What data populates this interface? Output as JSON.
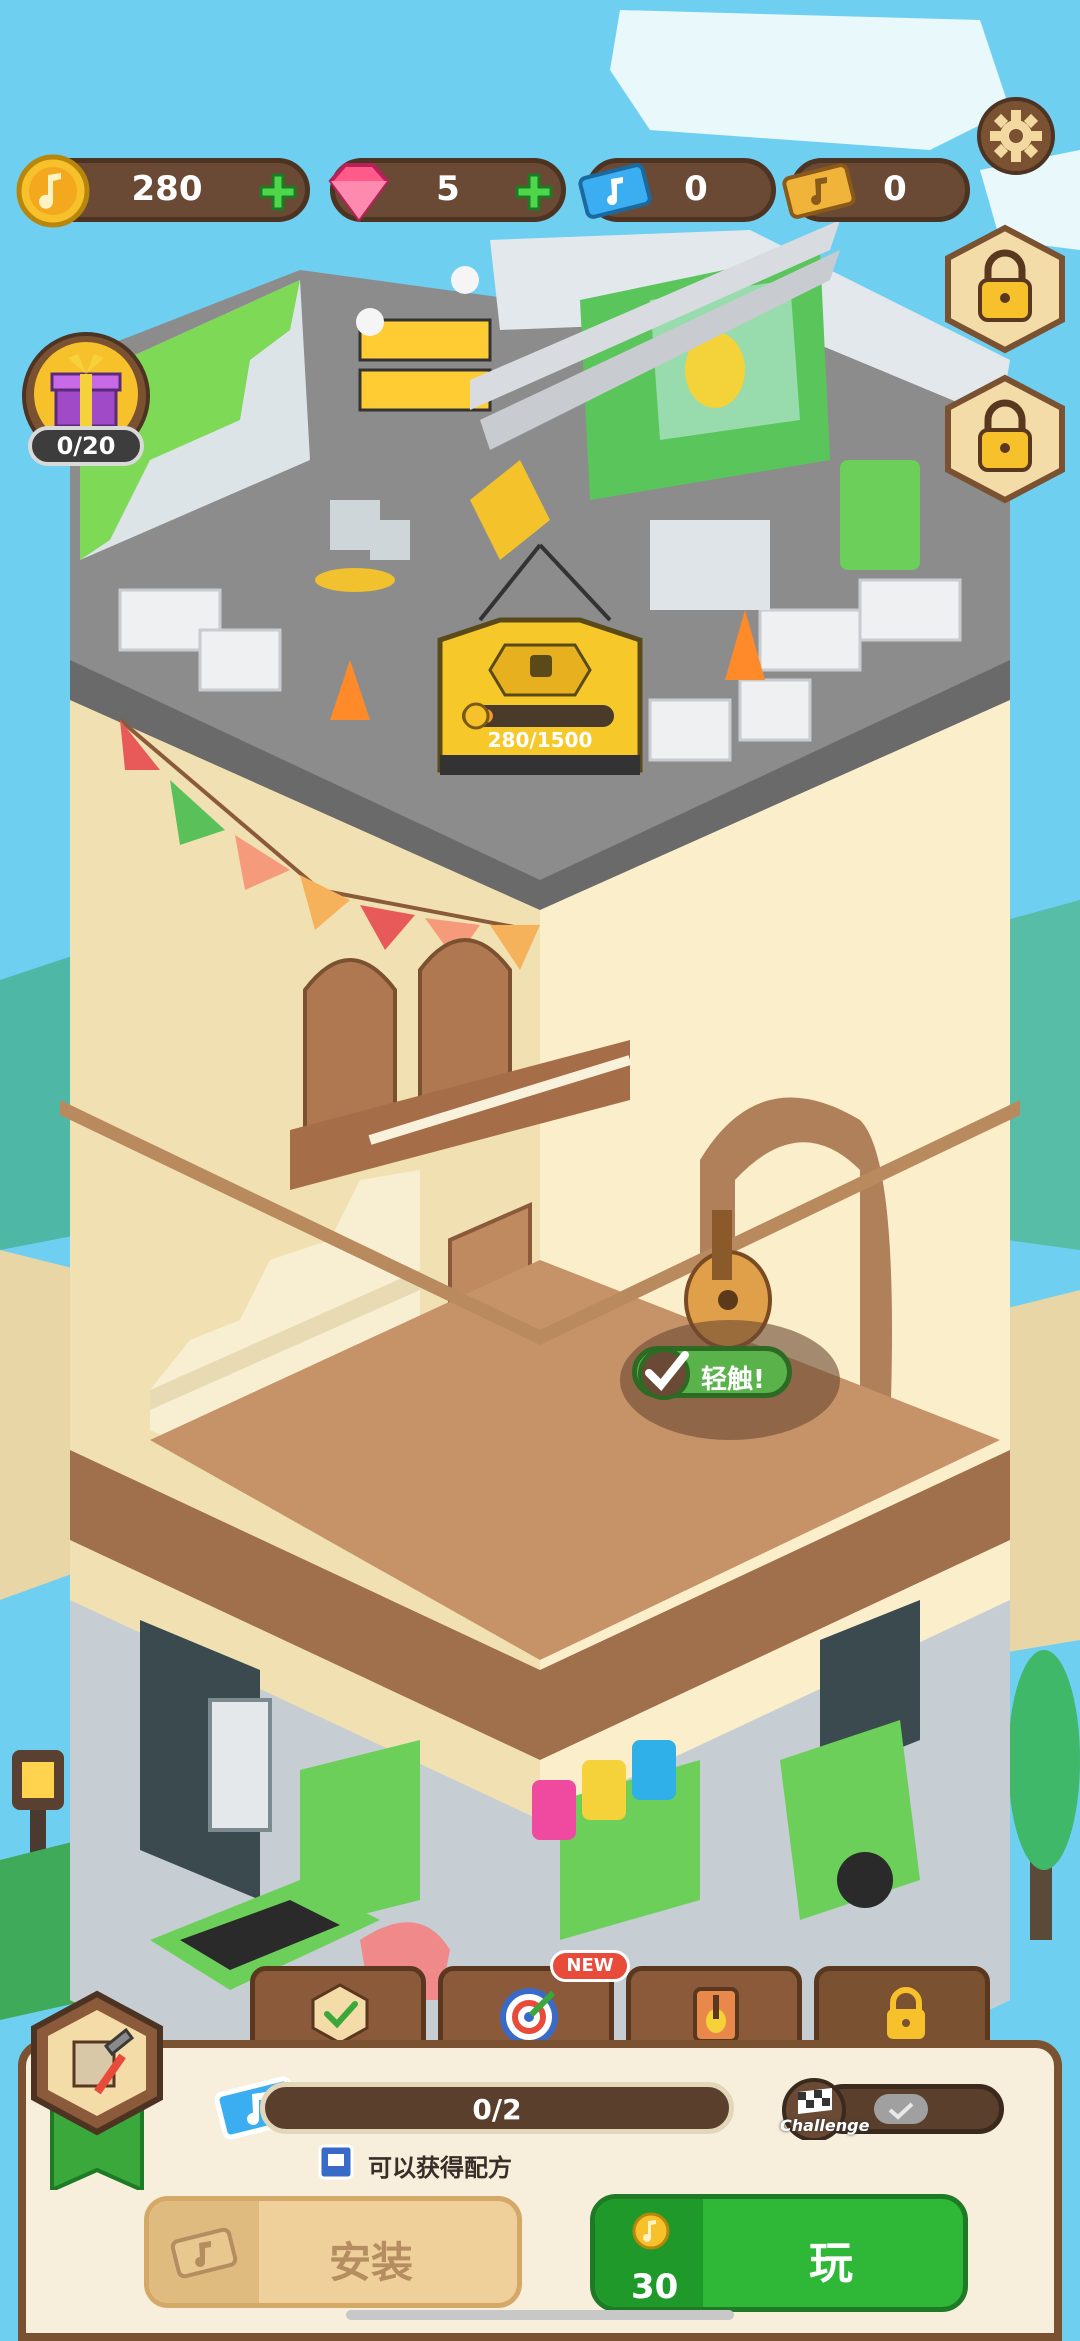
{
  "hud": {
    "notes": "280",
    "gems": "5",
    "blue_tickets": "0",
    "gold_tickets": "0"
  },
  "gift": {
    "count": "0/20"
  },
  "construction": {
    "progress_text": "280/1500",
    "progress": 0.187
  },
  "tap_prompt": "轻触!",
  "tabs": [
    {
      "icon": "checklist-icon"
    },
    {
      "icon": "target-icon",
      "badge": "NEW"
    },
    {
      "icon": "guitar-book-icon"
    },
    {
      "icon": "lock-icon"
    }
  ],
  "panel": {
    "ticket_progress": "0/2",
    "recipe_text": "可以获得配方",
    "challenge_label": "Challenge",
    "install_label": "安装",
    "play_label": "玩",
    "play_cost": "30"
  },
  "colors": {
    "sky": "#6ecff0",
    "hud_bg": "#6a4a34",
    "play_green": "#2fb838",
    "panel_bg": "#f7efdc"
  }
}
